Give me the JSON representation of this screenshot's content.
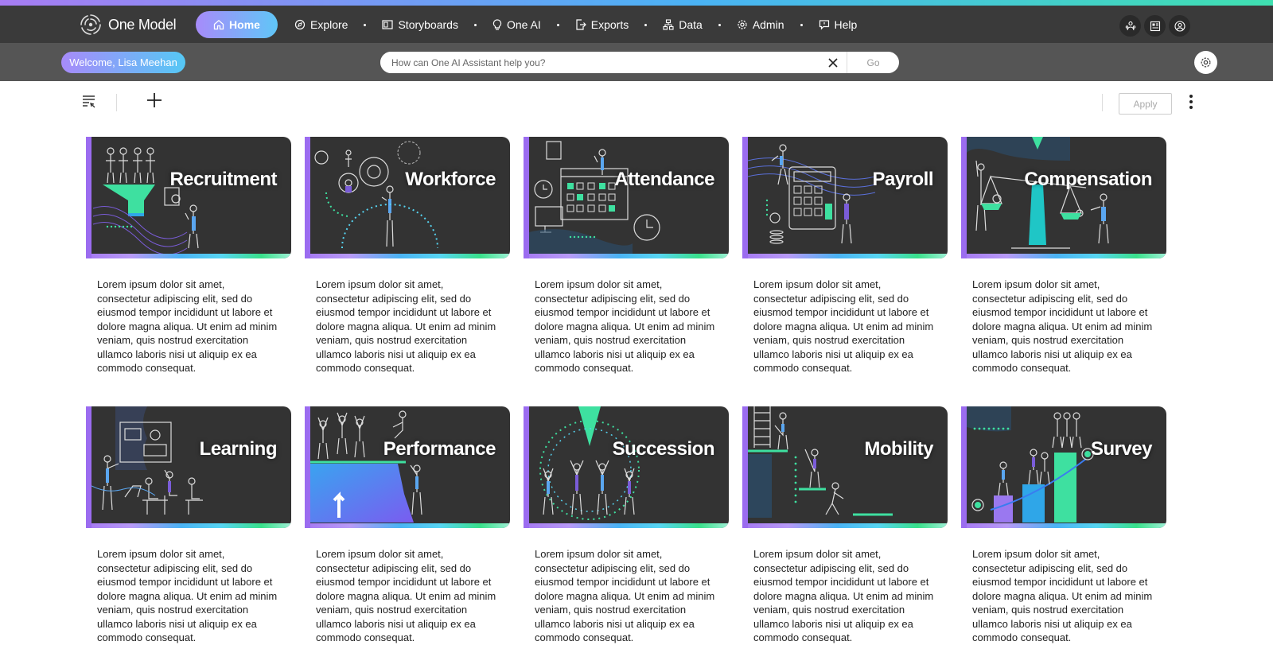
{
  "nav": {
    "logo_text": "One Model",
    "home_label": "Home",
    "items": [
      {
        "label": "Explore",
        "icon": "compass-icon"
      },
      {
        "label": "Storyboards",
        "icon": "storyboard-icon"
      },
      {
        "label": "One AI",
        "icon": "lightbulb-icon"
      },
      {
        "label": "Exports",
        "icon": "export-icon"
      },
      {
        "label": "Data",
        "icon": "data-icon"
      },
      {
        "label": "Admin",
        "icon": "gear-icon"
      },
      {
        "label": "Help",
        "icon": "help-chat-icon"
      }
    ]
  },
  "subbar": {
    "welcome": "Welcome, Lisa Meehan",
    "search_placeholder": "How can One AI Assistant help you?",
    "go_label": "Go"
  },
  "toolbar": {
    "apply_label": "Apply"
  },
  "cards": [
    {
      "title": "Recruitment",
      "desc": "Lorem ipsum dolor sit amet, consectetur adipiscing elit, sed do eiusmod tempor incididunt ut labore et dolore magna aliqua. Ut enim ad minim veniam, quis nostrud exercitation ullamco laboris nisi ut aliquip ex ea commodo consequat."
    },
    {
      "title": "Workforce",
      "desc": "Lorem ipsum dolor sit amet, consectetur adipiscing elit, sed do eiusmod tempor incididunt ut labore et dolore magna aliqua. Ut enim ad minim veniam, quis nostrud exercitation ullamco laboris nisi ut aliquip ex ea commodo consequat."
    },
    {
      "title": "Attendance",
      "desc": "Lorem ipsum dolor sit amet, consectetur adipiscing elit, sed do eiusmod tempor incididunt ut labore et dolore magna aliqua. Ut enim ad minim veniam, quis nostrud exercitation ullamco laboris nisi ut aliquip ex ea commodo consequat."
    },
    {
      "title": "Payroll",
      "desc": "Lorem ipsum dolor sit amet, consectetur adipiscing elit, sed do eiusmod tempor incididunt ut labore et dolore magna aliqua. Ut enim ad minim veniam, quis nostrud exercitation ullamco laboris nisi ut aliquip ex ea commodo consequat."
    },
    {
      "title": "Compensation",
      "desc": "Lorem ipsum dolor sit amet, consectetur adipiscing elit, sed do eiusmod tempor incididunt ut labore et dolore magna aliqua. Ut enim ad minim veniam, quis nostrud exercitation ullamco laboris nisi ut aliquip ex ea commodo consequat."
    },
    {
      "title": "Learning",
      "desc": "Lorem ipsum dolor sit amet, consectetur adipiscing elit, sed do eiusmod tempor incididunt ut labore et dolore magna aliqua. Ut enim ad minim veniam, quis nostrud exercitation ullamco laboris nisi ut aliquip ex ea commodo consequat."
    },
    {
      "title": "Performance",
      "desc": "Lorem ipsum dolor sit amet, consectetur adipiscing elit, sed do eiusmod tempor incididunt ut labore et dolore magna aliqua. Ut enim ad minim veniam, quis nostrud exercitation ullamco laboris nisi ut aliquip ex ea commodo consequat."
    },
    {
      "title": "Succession",
      "desc": "Lorem ipsum dolor sit amet, consectetur adipiscing elit, sed do eiusmod tempor incididunt ut labore et dolore magna aliqua. Ut enim ad minim veniam, quis nostrud exercitation ullamco laboris nisi ut aliquip ex ea commodo consequat."
    },
    {
      "title": "Mobility",
      "desc": "Lorem ipsum dolor sit amet, consectetur adipiscing elit, sed do eiusmod tempor incididunt ut labore et dolore magna aliqua. Ut enim ad minim veniam, quis nostrud exercitation ullamco laboris nisi ut aliquip ex ea commodo consequat."
    },
    {
      "title": "Survey",
      "desc": "Lorem ipsum dolor sit amet, consectetur adipiscing elit, sed do eiusmod tempor incididunt ut labore et dolore magna aliqua. Ut enim ad minim veniam, quis nostrud exercitation ullamco laboris nisi ut aliquip ex ea commodo consequat."
    }
  ],
  "colors": {
    "accent_purple": "#a77cf3",
    "accent_blue": "#4ab3f4",
    "accent_green": "#38e08a",
    "nav_bg": "#3a3a3a",
    "subbar_bg": "#555555",
    "card_bg": "#333333"
  }
}
